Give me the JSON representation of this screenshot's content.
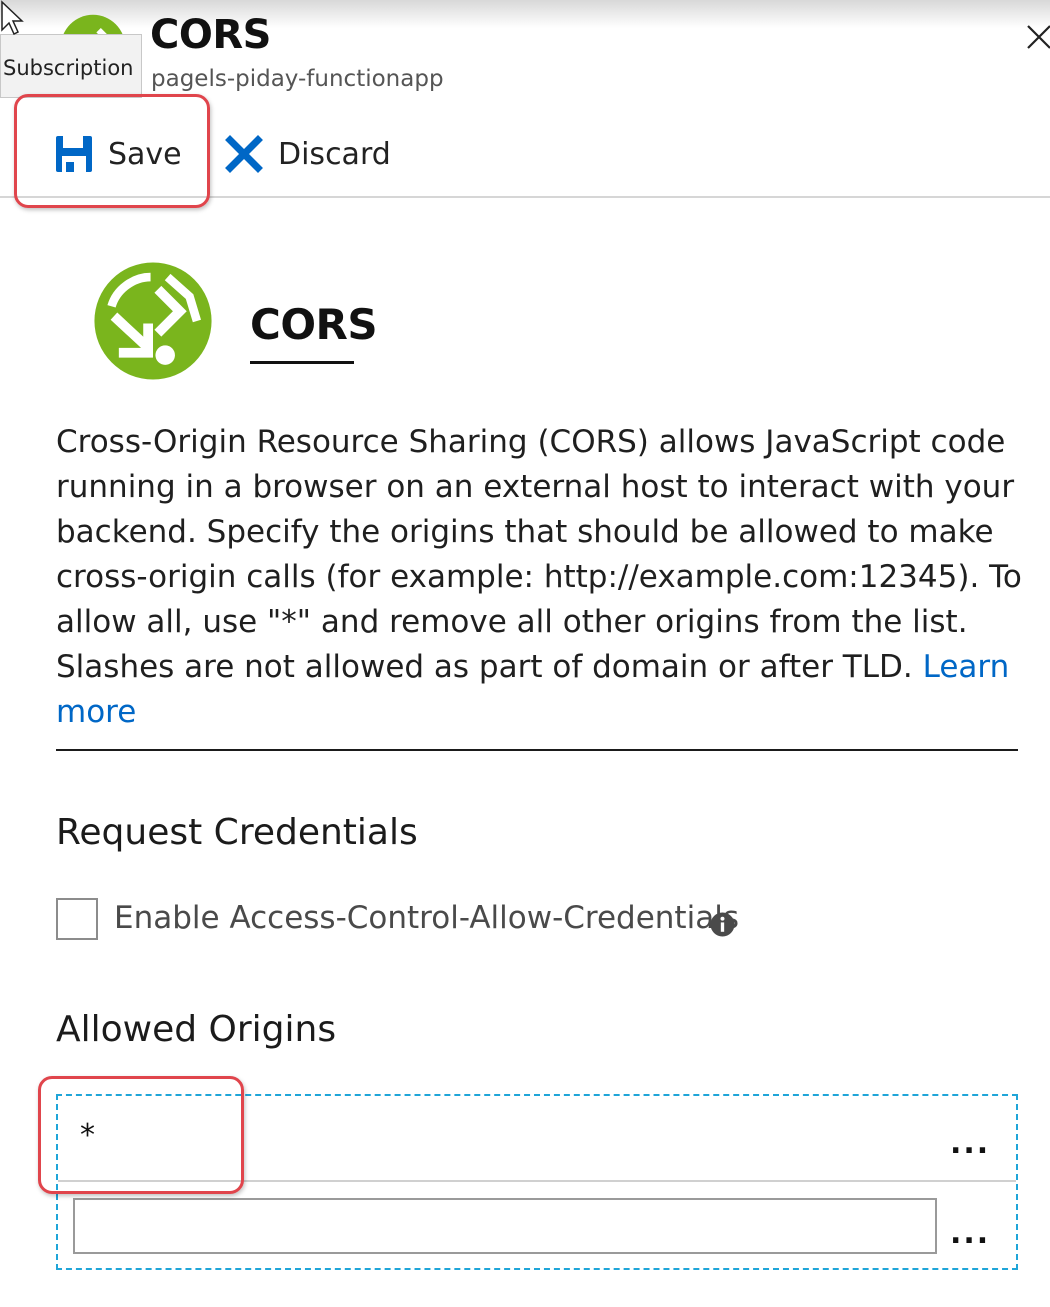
{
  "header": {
    "title": "CORS",
    "subtitle": "pagels-piday-functionapp",
    "tooltip": "Subscription"
  },
  "toolbar": {
    "save_label": "Save",
    "discard_label": "Discard"
  },
  "section": {
    "title": "CORS",
    "description": "Cross-Origin Resource Sharing (CORS) allows JavaScript code running in a browser on an external host to interact with your backend. Specify the origins that should be allowed to make cross-origin calls (for example: http://example.com:12345). To allow all, use \"*\" and remove all other origins from the list. Slashes are not allowed as part of domain or after TLD.",
    "learn_more": "Learn more"
  },
  "request_credentials": {
    "heading": "Request Credentials",
    "checkbox_label": "Enable Access-Control-Allow-Credentials",
    "checked": false
  },
  "allowed_origins": {
    "heading": "Allowed Origins",
    "rows": [
      {
        "value": "*",
        "more": "..."
      },
      {
        "value": "",
        "more": "..."
      }
    ]
  },
  "colors": {
    "logo_green": "#7ab51d",
    "save_blue": "#0067c6",
    "link_blue": "#0067c6",
    "highlight_red": "#e0454c",
    "dashed_border": "#1fa5d8"
  },
  "icons": {
    "logo": "cors-logo-icon",
    "save": "save-icon",
    "discard": "discard-x-icon",
    "close": "close-icon",
    "info": "info-icon",
    "cursor": "mouse-cursor-icon"
  }
}
